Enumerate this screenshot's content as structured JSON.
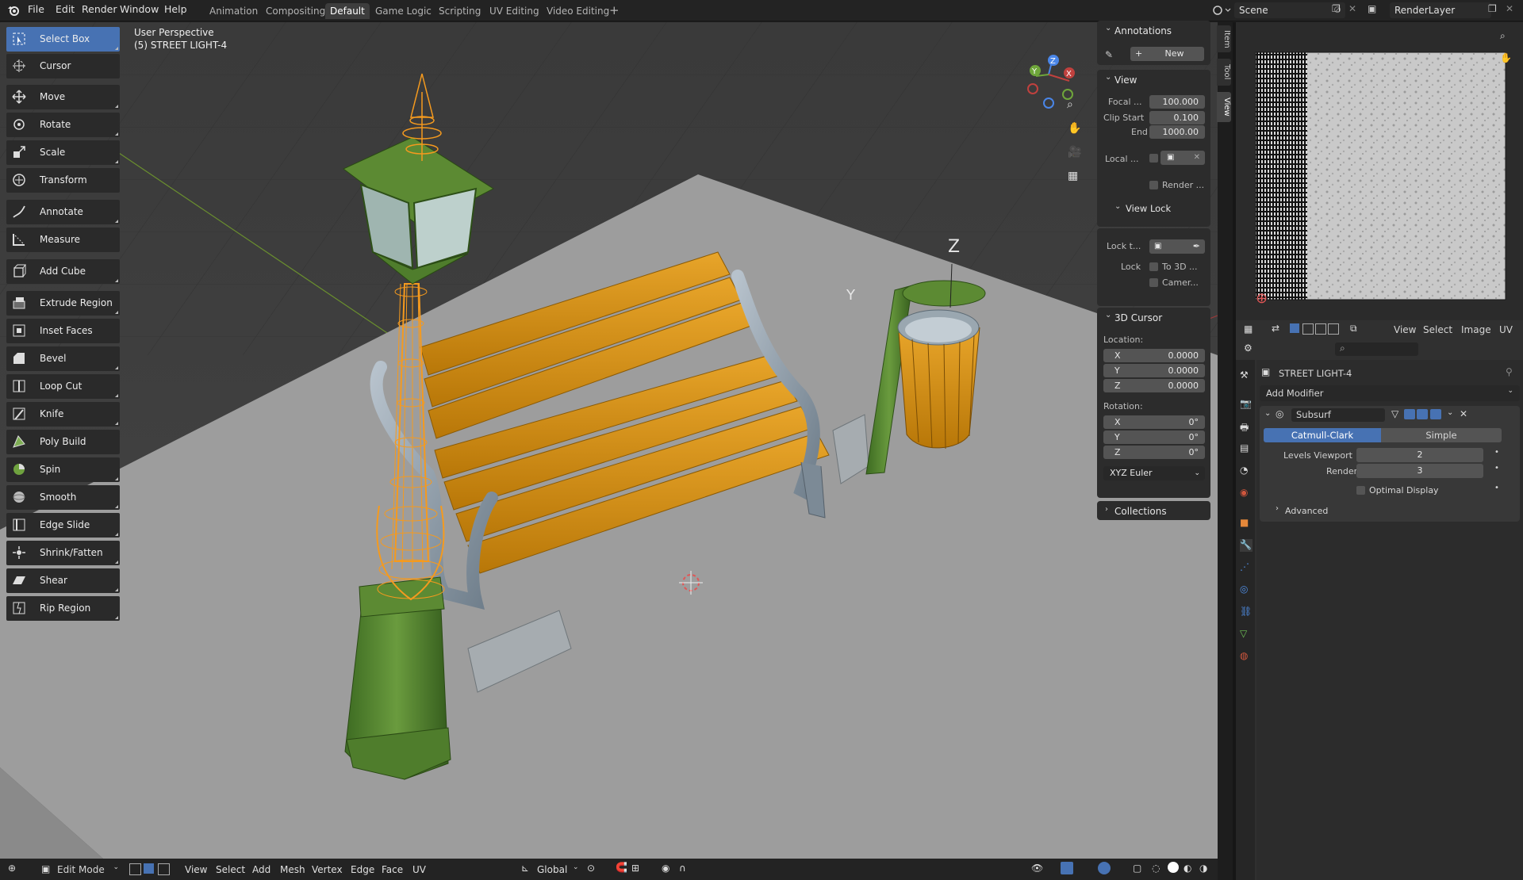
{
  "topbar": {
    "menus": [
      "File",
      "Edit",
      "Render",
      "Window",
      "Help"
    ],
    "workspaces": [
      "Animation",
      "Compositing",
      "Default",
      "Game Logic",
      "Scripting",
      "UV Editing",
      "Video Editing"
    ],
    "active_workspace": "Default",
    "add_tab": "+",
    "scene": "Scene",
    "render_layer": "RenderLayer"
  },
  "viewport": {
    "perspective": "User Perspective",
    "object": "(5) STREET LIGHT-4",
    "gizmo_labels": {
      "x": "X",
      "y": "Y",
      "z": "Z"
    },
    "empty_labels": {
      "z": "Z",
      "y": "Y"
    }
  },
  "toolbar": {
    "tools": [
      {
        "label": "Select Box",
        "icon": "select-box-icon",
        "active": true
      },
      {
        "label": "Cursor",
        "icon": "cursor-icon"
      },
      {
        "label": "Move",
        "icon": "move-icon"
      },
      {
        "label": "Rotate",
        "icon": "rotate-icon"
      },
      {
        "label": "Scale",
        "icon": "scale-icon"
      },
      {
        "label": "Transform",
        "icon": "transform-icon"
      },
      {
        "label": "Annotate",
        "icon": "annotate-icon"
      },
      {
        "label": "Measure",
        "icon": "measure-icon"
      },
      {
        "label": "Add Cube",
        "icon": "add-cube-icon"
      },
      {
        "label": "Extrude Region",
        "icon": "extrude-region-icon"
      },
      {
        "label": "Inset Faces",
        "icon": "inset-faces-icon"
      },
      {
        "label": "Bevel",
        "icon": "bevel-icon"
      },
      {
        "label": "Loop Cut",
        "icon": "loop-cut-icon"
      },
      {
        "label": "Knife",
        "icon": "knife-icon"
      },
      {
        "label": "Poly Build",
        "icon": "poly-build-icon"
      },
      {
        "label": "Spin",
        "icon": "spin-icon"
      },
      {
        "label": "Smooth",
        "icon": "smooth-icon"
      },
      {
        "label": "Edge Slide",
        "icon": "edge-slide-icon"
      },
      {
        "label": "Shrink/Fatten",
        "icon": "shrink-fatten-icon"
      },
      {
        "label": "Shear",
        "icon": "shear-icon"
      },
      {
        "label": "Rip Region",
        "icon": "rip-region-icon"
      }
    ]
  },
  "npanel": {
    "annotations": {
      "title": "Annotations",
      "new_button": "New"
    },
    "view": {
      "title": "View",
      "focal_label": "Focal ...",
      "focal_value": "100.000",
      "clip_start_label": "Clip Start",
      "clip_start_value": "0.100",
      "end_label": "End",
      "end_value": "1000.00",
      "local_label": "Local ...",
      "render_label": "Render ..."
    },
    "view_lock": {
      "title": "View Lock",
      "lock_to_label": "Lock t...",
      "lock_label": "Lock",
      "to3d_label": "To 3D ...",
      "camera_label": "Camer..."
    },
    "cursor": {
      "title": "3D Cursor",
      "location_label": "Location:",
      "loc": [
        {
          "axis": "X",
          "value": "0.0000"
        },
        {
          "axis": "Y",
          "value": "0.0000"
        },
        {
          "axis": "Z",
          "value": "0.0000"
        }
      ],
      "rotation_label": "Rotation:",
      "rot": [
        {
          "axis": "X",
          "value": "0°"
        },
        {
          "axis": "Y",
          "value": "0°"
        },
        {
          "axis": "Z",
          "value": "0°"
        }
      ],
      "rotation_mode": "XYZ Euler"
    },
    "collections": {
      "title": "Collections"
    },
    "tabs": [
      "Item",
      "Tool",
      "View"
    ]
  },
  "image_editor": {
    "menus": [
      "View",
      "Select",
      "Image",
      "UV"
    ]
  },
  "properties": {
    "object_name": "STREET LIGHT-4",
    "add_modifier": "Add Modifier",
    "modifier": {
      "name": "Subsurf",
      "type_a": "Catmull-Clark",
      "type_b": "Simple",
      "levels_viewport_label": "Levels Viewport",
      "levels_viewport_value": "2",
      "render_label": "Render",
      "render_value": "3",
      "optimal_display_label": "Optimal Display",
      "advanced_label": "Advanced"
    }
  },
  "bottombar": {
    "mode": "Edit Mode",
    "menus": [
      "View",
      "Select",
      "Add",
      "Mesh",
      "Vertex",
      "Edge",
      "Face",
      "UV"
    ],
    "orientation": "Global"
  },
  "colors": {
    "accent": "#4772b3",
    "selected_orange": "#f59a1e",
    "bench_wood": "#d99a1a",
    "lamp_green": "#4f7d2c"
  }
}
